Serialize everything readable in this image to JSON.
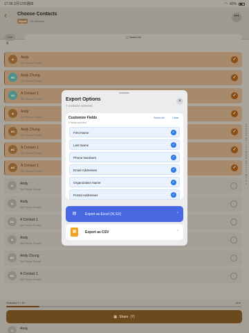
{
  "status_bar": {
    "time_date": "17:36  2月12日週四",
    "battery": "42%"
  },
  "header": {
    "title": "Choose Contacts",
    "import_chip": "Import",
    "contact_count": "49 contacts",
    "selected_count": "7/49",
    "select_all_label": "Select All"
  },
  "section_letter": "A",
  "contacts": [
    {
      "initials": "A",
      "name": "Andy",
      "phone": "No Phone Found",
      "selected": true,
      "avatar": "letter"
    },
    {
      "initials": "AC",
      "name": "Andy Chung",
      "phone": "No Phone Found",
      "selected": true,
      "avatar": "photo"
    },
    {
      "initials": "A1",
      "name": "A Contact 1",
      "phone": "No Phone Found",
      "selected": true,
      "avatar": "photo"
    },
    {
      "initials": "A",
      "name": "Andy",
      "phone": "No Phone Found",
      "selected": true,
      "avatar": "letter"
    },
    {
      "initials": "AC",
      "name": "Andy Chung",
      "phone": "No Phone Found",
      "selected": true,
      "avatar": "letter"
    },
    {
      "initials": "AC",
      "name": "A Contact 1",
      "phone": "No Phone Found",
      "selected": true,
      "avatar": "letter"
    },
    {
      "initials": "AC",
      "name": "A Contact 1",
      "phone": "No Phone Found",
      "selected": true,
      "avatar": "letter"
    },
    {
      "initials": "A",
      "name": "Andy",
      "phone": "No Phone Found",
      "selected": false,
      "avatar": "letter"
    },
    {
      "initials": "A",
      "name": "Andy",
      "phone": "No Phone Found",
      "selected": false,
      "avatar": "letter"
    },
    {
      "initials": "AC",
      "name": "A Contact 1",
      "phone": "No Phone Found",
      "selected": false,
      "avatar": "letter"
    },
    {
      "initials": "A",
      "name": "Andy",
      "phone": "No Phone Found",
      "selected": false,
      "avatar": "letter"
    },
    {
      "initials": "AC",
      "name": "Andy Chung",
      "phone": "No Phone Found",
      "selected": false,
      "avatar": "letter"
    },
    {
      "initials": "AC",
      "name": "A Contact 1",
      "phone": "No Phone Found",
      "selected": false,
      "avatar": "letter"
    }
  ],
  "index_letters": [
    "A",
    "B",
    "C",
    "D",
    "E",
    "F",
    "G",
    "H",
    "I",
    "J",
    "K",
    "L",
    "M",
    "N",
    "O",
    "P",
    "Q",
    "R",
    "S",
    "T",
    "U",
    "V",
    "W",
    "X",
    "Y",
    "Z",
    "#"
  ],
  "footer": {
    "selected_text": "Selected 7 / 49",
    "percent": "14%",
    "progress": 0.14,
    "share_label": "Share",
    "share_count": "(7)",
    "peek_initials": "A",
    "peek_name": "Andy"
  },
  "modal": {
    "title": "Export Options",
    "subtitle": "7 contacts selected",
    "fields_title": "Customize Fields",
    "fields_subtitle": "6 fields selected",
    "select_all": "Select All",
    "clear": "Clear",
    "fields": [
      "First Name",
      "Last Name",
      "Phone Numbers",
      "Email Addresses",
      "Organization Name",
      "Postal Addresses"
    ],
    "export_xlsx": "Export as Excel (XLSX)",
    "export_csv": "Export as CSV"
  },
  "colors": {
    "accent": "#8a4d12",
    "xlsx": "#4768e0",
    "csv_icon": "#f2a21e",
    "field_check": "#2f7be5"
  }
}
